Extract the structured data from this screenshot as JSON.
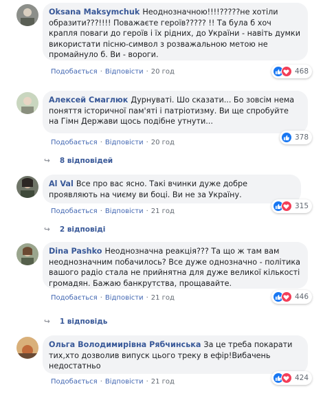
{
  "actions": {
    "like": "Подобається",
    "reply": "Відповісти",
    "sep": "·"
  },
  "comments": [
    {
      "author": "Oksana Maksymchuk",
      "text": "Неоднозначною!!!!?????не хотіли образити???!!!! Поважаєте героїв????? !! Та була б хоч крапля поваги до героїв і їх рідних, до України - навіть думки використати пісню-символ з розважальною метою не промайнуло б. Ви - вороги.",
      "time": "20 год",
      "reaction_count": "468",
      "reactions": [
        "like-icon",
        "love-icon"
      ]
    },
    {
      "author": "Алексей Смаглюк",
      "text": "Дурнуваті. Шо сказати... Бо зовсім нема поняття історичної пам'яті і патріотизму. Ви ще спробуйте на Гімн Держави щось подібне утнути...",
      "time": "20 год",
      "reaction_count": "378",
      "reactions": [
        "like-icon"
      ],
      "replies_label": "8 відповідей"
    },
    {
      "author": "Al Val",
      "text": "Все про вас ясно. Такі вчинки дуже добре проявляють на чиєму ви боці. Ви не за Україну.",
      "time": "21 год",
      "reaction_count": "315",
      "reactions": [
        "like-icon",
        "love-icon"
      ],
      "replies_label": "2 відповіді"
    },
    {
      "author": "Dina Pashko",
      "text": "Неоднозначна реакція??? Та що ж там вам неоднозначним побачилось? Все дуже однозначно - політика вашого радіо стала не прийнятна для дуже великої кількості громадян. Бажаю банкрутства, прощавайте.",
      "time": "21 год",
      "reaction_count": "446",
      "reactions": [
        "like-icon",
        "love-icon"
      ],
      "replies_label": "1 відповідь"
    },
    {
      "author": "Ольга Володимирівна Рябчинська",
      "text": "За це треба покарати тих,хто дозволив випуск цього треку в ефір!Вибачень недостатньо",
      "time": "21 год",
      "reaction_count": "424",
      "reactions": [
        "like-icon",
        "love-icon"
      ]
    }
  ],
  "colors": {
    "like": "#1877f2",
    "love": "#f33e58",
    "link": "#385898",
    "bubble": "#f2f3f5"
  }
}
